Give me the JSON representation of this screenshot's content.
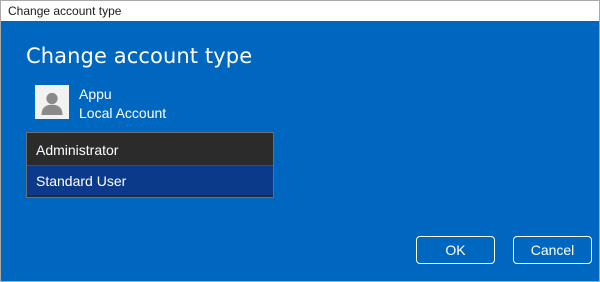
{
  "window": {
    "title": "Change account type"
  },
  "dialog": {
    "heading": "Change account type",
    "user": {
      "name": "Appu",
      "account_type": "Local Account",
      "avatar_icon": "person-icon"
    },
    "account_types": {
      "options": [
        "Administrator",
        "Standard User"
      ],
      "selected": "Standard User"
    },
    "buttons": {
      "ok_label": "OK",
      "cancel_label": "Cancel"
    }
  },
  "colors": {
    "background": "#0067c0",
    "titlebar": "#ffffff",
    "listbox_bg": "#2b2b2b",
    "selected_option": "#0b3a8a",
    "text": "#ffffff"
  }
}
